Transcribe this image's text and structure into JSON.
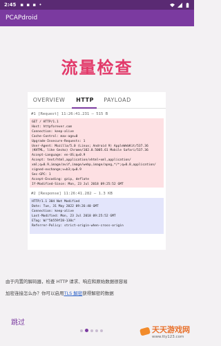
{
  "status_bar": {
    "time": "2:45",
    "icons_left": "▪ ▪ ▪ •",
    "wifi_icon": "wifi-icon",
    "signal_icon": "signal-icon",
    "battery_icon": "battery-icon"
  },
  "app_bar": {
    "title": "PCAPdroid"
  },
  "headline": "流量检查",
  "tabs": [
    {
      "label": "OVERVIEW",
      "selected": false
    },
    {
      "label": "HTTP",
      "selected": true
    },
    {
      "label": "PAYLOAD",
      "selected": false
    }
  ],
  "request": {
    "header": "#1 [Request] 11:26:41.231 — 515 B",
    "lines": [
      "GET / HTTP/1.1",
      "Host: httpforever.com",
      "Connection: keep-alive",
      "Cache-Control: max-age=0",
      "Upgrade-Insecure-Requests: 1",
      "User-Agent: Mozilla/5.0 (Linux; Android 9) AppleWebKit/537.36",
      "(KHTML, like Gecko) Chrome/102.0.5005.61 Mobile Safari/537.36",
      "Accept-Language: en-US;q=0.9",
      "Accept: text/html,application/xhtml+xml,application/",
      "xml;q=0.9,image/avif,image/webp,image/apng,*/*;q=0.8,application/",
      "signed-exchange;v=b3;q=0.9",
      "Sec-GPC: 1",
      "Accept-Encoding: gzip, deflate",
      "If-Modified-Since: Mon, 23 Jul 2018 09:25:52 GMT"
    ]
  },
  "response": {
    "header": "#2 [Response] 11:26:41.282 — 1.3 KB",
    "lines": [
      "HTTP/1.1 304 Not Modified",
      "Date: Tue, 31 May 2022 09:26:40 GMT",
      "Connection: keep-alive",
      "Last-Modified: Mon, 23 Jul 2018 09:25:52 GMT",
      "ETag: W/\"5b559f28-130c\"",
      "Referrer-Policy: strict-origin-when-cross-origin"
    ]
  },
  "description": {
    "line1": "由于内置的解码器，检查 HTTP 请求、响应和原始数据很容易",
    "line2_prefix": "加密连接怎么办？你可以启用",
    "line2_link": "TLS 解密",
    "line2_suffix": "获得解密的数据"
  },
  "bottom": {
    "skip_label": "跳过",
    "page_count": 5,
    "current_page": 2
  },
  "watermark": {
    "title": "天天游戏网",
    "url": "www.tty123.com"
  },
  "colors": {
    "status_bar": "#5a2a73",
    "app_bar": "#7b3aa0",
    "headline": "#e23a6a",
    "request_bg": "#fde0e3",
    "response_bg": "#e3e5fb",
    "link": "#2b62c8"
  }
}
